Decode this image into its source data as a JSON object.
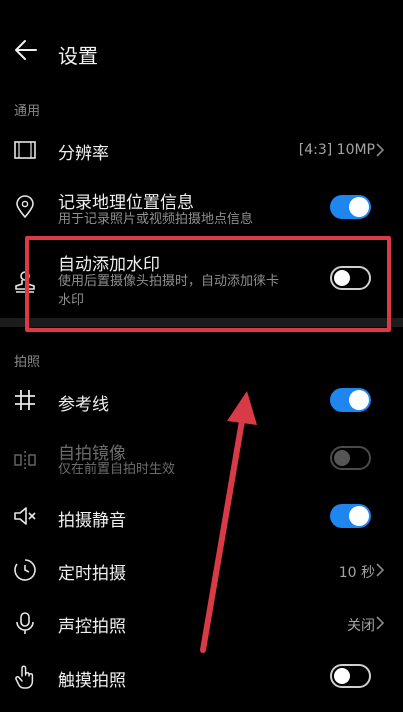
{
  "header": {
    "title": "设置"
  },
  "sections": {
    "general": "通用",
    "photo": "拍照"
  },
  "rows": {
    "resolution": {
      "title": "分辨率",
      "value": "[4:3] 10MP"
    },
    "location": {
      "title": "记录地理位置信息",
      "subtitle": "用于记录照片或视频拍摄地点信息",
      "enabled": true
    },
    "watermark": {
      "title": "自动添加水印",
      "subtitle_line1": "使用后置摄像头拍摄时，自动添加徕卡",
      "subtitle_line2": "水印",
      "enabled": false
    },
    "grid": {
      "title": "参考线",
      "enabled": true
    },
    "mirror": {
      "title": "自拍镜像",
      "subtitle": "仅在前置自拍时生效",
      "enabled": false,
      "disabled": true
    },
    "mute": {
      "title": "拍摄静音",
      "enabled": true
    },
    "timer": {
      "title": "定时拍摄",
      "value": "10 秒"
    },
    "voice": {
      "title": "声控拍照",
      "value": "关闭"
    },
    "touch": {
      "title": "触摸拍照",
      "enabled": false
    }
  },
  "colors": {
    "accent": "#1f86f0",
    "annotation": "#d83a46"
  }
}
